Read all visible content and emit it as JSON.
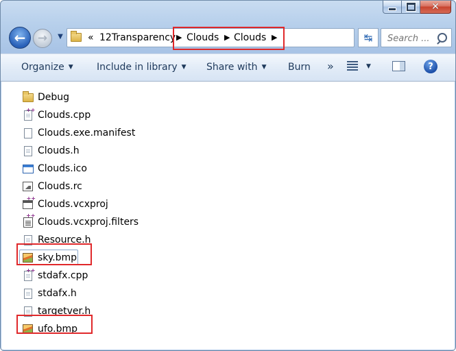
{
  "window": {
    "caption": {
      "minimize_icon": "minimize-icon",
      "maximize_icon": "maximize-icon",
      "close_icon": "close-icon",
      "close_glyph": "✕"
    }
  },
  "nav": {
    "back_glyph": "←",
    "forward_glyph": "→",
    "recent_glyph": "▼",
    "address": {
      "overflow": "«",
      "segments": [
        "12Transparency",
        "Clouds",
        "Clouds"
      ],
      "separator": "▶"
    },
    "refresh_glyph": "↹",
    "search_placeholder": "Search ..."
  },
  "toolbar": {
    "organize": "Organize",
    "include": "Include in library",
    "share": "Share with",
    "burn": "Burn",
    "more": "»",
    "caret": "▼",
    "help": "?"
  },
  "files": [
    {
      "name": "Debug",
      "icon": "folder-icon"
    },
    {
      "name": "Clouds.cpp",
      "icon": "cpp-file-icon"
    },
    {
      "name": "Clouds.exe.manifest",
      "icon": "file-icon"
    },
    {
      "name": "Clouds.h",
      "icon": "header-file-icon"
    },
    {
      "name": "Clouds.ico",
      "icon": "ico-file-icon"
    },
    {
      "name": "Clouds.rc",
      "icon": "resource-file-icon"
    },
    {
      "name": "Clouds.vcxproj",
      "icon": "vcxproj-file-icon"
    },
    {
      "name": "Clouds.vcxproj.filters",
      "icon": "filters-file-icon"
    },
    {
      "name": "Resource.h",
      "icon": "header-file-icon"
    },
    {
      "name": "sky.bmp",
      "icon": "bitmap-file-icon"
    },
    {
      "name": "stdafx.cpp",
      "icon": "cpp-file-icon"
    },
    {
      "name": "stdafx.h",
      "icon": "header-file-icon"
    },
    {
      "name": "targetver.h",
      "icon": "header-file-icon"
    },
    {
      "name": "ufo.bmp",
      "icon": "bitmap-file-icon"
    }
  ],
  "colors": {
    "highlight": "#e0282a",
    "toolbar_text": "#1e395b"
  }
}
